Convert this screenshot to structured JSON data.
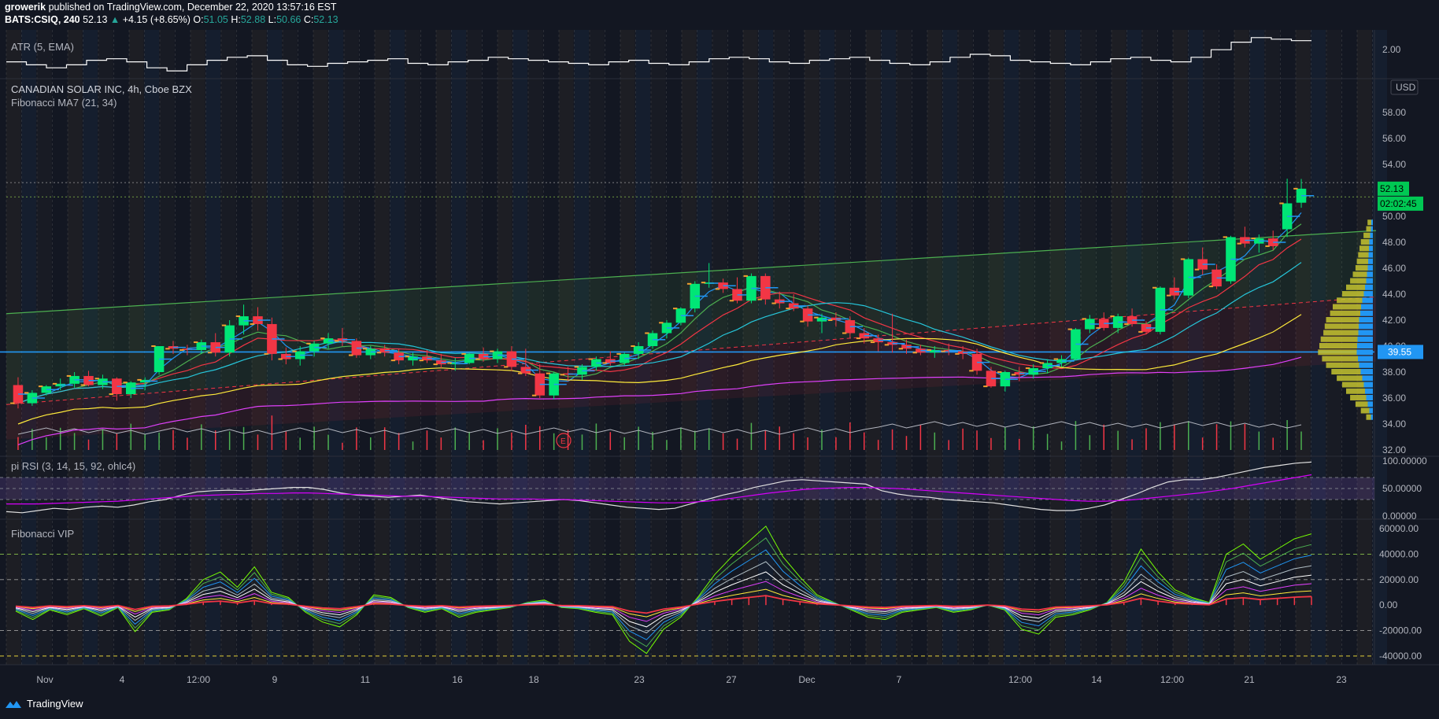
{
  "header": {
    "line1": {
      "user": "growerik",
      "rest": " published on TradingView.com, December 22, 2020 13:57:16 EST"
    },
    "line2": {
      "symbol": "BATS:CSIQ, 240",
      "last": "52.13",
      "arrow": "▲",
      "change": "+4.15 (+8.65%)",
      "o_label": "O:",
      "o": "51.05",
      "h_label": "H:",
      "h": "52.88",
      "l_label": "L:",
      "l": "50.66",
      "c_label": "C:",
      "c": "52.13"
    }
  },
  "panes": {
    "atr": {
      "label": "ATR (5, EMA)"
    },
    "main": {
      "title": "CANADIAN SOLAR INC, 4h, Cboe BZX",
      "indicator": "Fibonacci MA7 (21, 34)",
      "currency": "USD"
    },
    "rsi": {
      "label": "pi RSI (3, 14, 15, 92, ohlc4)"
    },
    "vip": {
      "label": "Fibonacci VIP"
    }
  },
  "badges": {
    "last_price": "52.13",
    "countdown": "02:02:45",
    "hline": "39.55"
  },
  "event_marker": "E",
  "footer": {
    "brand": "TradingView"
  },
  "colors": {
    "up": "#00e676",
    "down": "#f23645",
    "bg": "#131722",
    "blue": "#2196f3",
    "lime": "#4caf50",
    "yellow": "#ffeb3b",
    "magenta": "#e040fb"
  },
  "chart_data": [
    {
      "type": "line",
      "name": "ATR (5, EMA)",
      "y_ticks": [
        "2.00"
      ],
      "values": [
        1.92,
        1.9,
        1.88,
        1.9,
        1.93,
        1.94,
        1.92,
        1.88,
        1.86,
        1.9,
        1.93,
        1.95,
        1.96,
        1.93,
        1.9,
        1.89,
        1.91,
        1.92,
        1.93,
        1.94,
        1.91,
        1.9,
        1.92,
        1.93,
        1.95,
        1.94,
        1.93,
        1.92,
        1.91,
        1.9,
        1.92,
        1.93,
        1.91,
        1.9,
        1.92,
        1.94,
        1.95,
        1.94,
        1.92,
        1.91,
        1.93,
        1.94,
        1.95,
        1.93,
        1.91,
        1.9,
        1.92,
        1.95,
        1.97,
        1.96,
        1.93,
        1.92,
        1.91,
        1.9,
        1.92,
        1.94,
        1.95,
        1.93,
        1.92,
        1.95,
        2.0,
        2.05,
        2.08,
        2.07,
        2.06
      ]
    },
    {
      "type": "candlestick",
      "title": "CANADIAN SOLAR INC, 4h, Cboe BZX",
      "ylim": [
        32,
        60
      ],
      "y_ticks": [
        "58.00",
        "56.00",
        "54.00",
        "52.00",
        "50.00",
        "48.00",
        "46.00",
        "44.00",
        "42.00",
        "40.00",
        "38.00",
        "36.00",
        "34.00",
        "32.00"
      ],
      "x_ticks": [
        "Nov",
        "4",
        "12:00",
        "9",
        "11",
        "16",
        "18",
        "23",
        "27",
        "Dec",
        "7",
        "12:00",
        "14",
        "12:00",
        "21",
        "23"
      ],
      "candles": [
        [
          37.0,
          37.6,
          35.2,
          35.6
        ],
        [
          35.6,
          36.6,
          35.4,
          36.4
        ],
        [
          36.4,
          37.0,
          36.2,
          36.9
        ],
        [
          36.9,
          37.5,
          36.6,
          37.1
        ],
        [
          37.1,
          38.0,
          36.8,
          37.7
        ],
        [
          37.7,
          38.1,
          36.9,
          37.0
        ],
        [
          37.0,
          37.8,
          36.7,
          37.5
        ],
        [
          37.5,
          37.6,
          35.8,
          36.3
        ],
        [
          36.3,
          37.3,
          36.0,
          37.2
        ],
        [
          37.2,
          37.6,
          36.6,
          37.4
        ],
        [
          38.0,
          40.0,
          37.8,
          40.0
        ],
        [
          40.0,
          40.4,
          39.4,
          39.8
        ],
        [
          39.8,
          40.1,
          39.3,
          39.7
        ],
        [
          39.7,
          40.5,
          39.4,
          40.3
        ],
        [
          40.3,
          41.0,
          39.2,
          39.5
        ],
        [
          39.5,
          42.0,
          39.2,
          41.6
        ],
        [
          41.6,
          43.2,
          40.9,
          42.3
        ],
        [
          42.3,
          43.0,
          41.2,
          41.7
        ],
        [
          41.7,
          42.2,
          38.9,
          39.4
        ],
        [
          39.4,
          39.9,
          38.6,
          39.0
        ],
        [
          39.0,
          40.0,
          38.5,
          39.6
        ],
        [
          39.6,
          40.4,
          39.2,
          40.2
        ],
        [
          40.2,
          41.0,
          39.8,
          40.6
        ],
        [
          40.6,
          41.4,
          40.0,
          40.4
        ],
        [
          40.4,
          40.6,
          39.1,
          39.3
        ],
        [
          39.3,
          40.0,
          39.0,
          39.8
        ],
        [
          39.8,
          40.1,
          39.2,
          39.5
        ],
        [
          39.5,
          39.8,
          38.6,
          38.9
        ],
        [
          38.9,
          39.5,
          38.5,
          39.2
        ],
        [
          39.2,
          39.7,
          38.7,
          38.9
        ],
        [
          38.9,
          39.4,
          38.3,
          38.6
        ],
        [
          38.6,
          39.1,
          38.1,
          38.7
        ],
        [
          38.7,
          39.5,
          38.6,
          39.4
        ],
        [
          39.4,
          39.9,
          38.8,
          39.0
        ],
        [
          39.0,
          39.8,
          38.7,
          39.6
        ],
        [
          39.6,
          40.0,
          38.1,
          38.4
        ],
        [
          38.4,
          39.8,
          37.7,
          37.9
        ],
        [
          37.9,
          38.6,
          36.0,
          36.2
        ],
        [
          36.2,
          38.0,
          35.9,
          37.9
        ],
        [
          37.9,
          38.4,
          37.3,
          37.8
        ],
        [
          37.8,
          38.6,
          37.4,
          38.4
        ],
        [
          38.4,
          39.2,
          38.1,
          39.0
        ],
        [
          39.0,
          39.6,
          38.5,
          38.7
        ],
        [
          38.7,
          39.5,
          38.5,
          39.4
        ],
        [
          39.4,
          40.3,
          39.0,
          40.0
        ],
        [
          40.0,
          41.2,
          39.8,
          41.0
        ],
        [
          41.0,
          42.0,
          40.6,
          41.8
        ],
        [
          41.8,
          43.0,
          41.6,
          42.9
        ],
        [
          42.9,
          45.0,
          42.6,
          44.8
        ],
        [
          44.8,
          46.4,
          44.5,
          44.9
        ],
        [
          44.9,
          45.2,
          44.1,
          44.4
        ],
        [
          44.4,
          45.3,
          43.3,
          43.5
        ],
        [
          43.5,
          45.6,
          43.3,
          45.4
        ],
        [
          45.4,
          45.6,
          43.2,
          43.6
        ],
        [
          43.6,
          44.2,
          42.9,
          43.3
        ],
        [
          43.3,
          44.0,
          42.7,
          42.9
        ],
        [
          42.9,
          43.1,
          41.5,
          41.9
        ],
        [
          41.9,
          42.5,
          41.0,
          42.2
        ],
        [
          42.2,
          42.6,
          41.5,
          42.0
        ],
        [
          42.0,
          42.3,
          40.6,
          41.0
        ],
        [
          41.0,
          41.4,
          40.2,
          40.6
        ],
        [
          40.6,
          40.9,
          39.6,
          40.3
        ],
        [
          40.3,
          42.5,
          39.5,
          40.1
        ],
        [
          40.1,
          40.5,
          39.4,
          39.8
        ],
        [
          39.8,
          40.1,
          39.3,
          39.5
        ],
        [
          39.5,
          40.0,
          39.1,
          39.7
        ],
        [
          39.7,
          40.2,
          39.3,
          39.6
        ],
        [
          39.6,
          40.0,
          39.0,
          39.4
        ],
        [
          39.4,
          39.8,
          37.8,
          38.1
        ],
        [
          38.1,
          38.4,
          36.8,
          36.9
        ],
        [
          36.9,
          38.1,
          36.5,
          38.0
        ],
        [
          38.0,
          38.4,
          37.3,
          37.8
        ],
        [
          37.8,
          38.6,
          37.5,
          38.3
        ],
        [
          38.3,
          39.0,
          37.9,
          38.7
        ],
        [
          38.7,
          39.3,
          38.4,
          39.0
        ],
        [
          39.0,
          41.4,
          38.9,
          41.3
        ],
        [
          41.3,
          42.4,
          41.0,
          42.1
        ],
        [
          42.1,
          42.6,
          41.2,
          41.4
        ],
        [
          41.4,
          42.5,
          41.0,
          42.3
        ],
        [
          42.3,
          42.9,
          41.5,
          41.7
        ],
        [
          41.7,
          41.9,
          40.9,
          41.1
        ],
        [
          41.1,
          44.6,
          40.9,
          44.5
        ],
        [
          44.5,
          45.3,
          43.6,
          43.9
        ],
        [
          43.9,
          46.8,
          43.7,
          46.7
        ],
        [
          46.7,
          47.6,
          45.5,
          45.9
        ],
        [
          45.9,
          46.3,
          44.4,
          44.6
        ],
        [
          45.0,
          48.5,
          44.8,
          48.4
        ],
        [
          48.4,
          49.2,
          47.6,
          47.9
        ],
        [
          47.9,
          48.6,
          47.2,
          48.3
        ],
        [
          48.3,
          48.9,
          47.4,
          47.7
        ],
        [
          49.0,
          52.9,
          48.4,
          51.0
        ],
        [
          51.05,
          52.88,
          50.66,
          52.13
        ]
      ],
      "horizontal_line": 39.55,
      "last_price": 52.13
    },
    {
      "type": "line",
      "name": "pi RSI (3, 14, 15, 92, ohlc4)",
      "ylim": [
        0,
        100
      ],
      "y_ticks": [
        "100.00000",
        "50.00000",
        "0.00000"
      ],
      "series": [
        {
          "color": "white",
          "values": [
            8,
            6,
            10,
            14,
            12,
            16,
            18,
            16,
            20,
            26,
            30,
            38,
            44,
            46,
            47,
            46,
            48,
            50,
            52,
            52,
            48,
            42,
            38,
            36,
            34,
            36,
            38,
            34,
            30,
            26,
            24,
            22,
            24,
            26,
            28,
            30,
            28,
            24,
            20,
            16,
            14,
            12,
            14,
            22,
            30,
            38,
            44,
            52,
            58,
            64,
            66,
            64,
            62,
            60,
            58,
            46,
            40,
            36,
            34,
            30,
            28,
            26,
            24,
            20,
            16,
            12,
            10,
            10,
            14,
            20,
            30,
            40,
            52,
            62,
            66,
            66,
            70,
            76,
            82,
            88,
            92,
            96,
            98
          ]
        },
        {
          "color": "magenta",
          "values": [
            22,
            22,
            22,
            23,
            24,
            25,
            26,
            27,
            29,
            31,
            33,
            35,
            37,
            38,
            39,
            40,
            41,
            41,
            42,
            42,
            41,
            40,
            39,
            38,
            37,
            36,
            36,
            35,
            34,
            33,
            32,
            31,
            31,
            31,
            30,
            30,
            29,
            28,
            27,
            26,
            25,
            24,
            24,
            25,
            27,
            30,
            34,
            38,
            42,
            45,
            48,
            50,
            51,
            52,
            52,
            51,
            50,
            48,
            46,
            44,
            42,
            40,
            38,
            36,
            34,
            32,
            30,
            28,
            27,
            27,
            28,
            30,
            33,
            36,
            39,
            42,
            46,
            50,
            55,
            60,
            65,
            70,
            75
          ]
        }
      ]
    },
    {
      "type": "line",
      "name": "Fibonacci VIP",
      "ylim": [
        -45000,
        65000
      ],
      "y_ticks": [
        "60000.00",
        "40000.00",
        "20000.00",
        "0.00",
        "-20000.00",
        "-40000.00"
      ],
      "values": [
        -5000,
        -12000,
        -4000,
        -8000,
        -3000,
        -9000,
        -2000,
        -22000,
        -6000,
        -4000,
        5000,
        20000,
        26000,
        14000,
        30000,
        10000,
        6000,
        -6000,
        -14000,
        -18000,
        -8000,
        8000,
        6000,
        -2000,
        -6000,
        -3000,
        -10000,
        -6000,
        -4000,
        -2000,
        2000,
        4000,
        -2000,
        -3000,
        -6000,
        -8000,
        -30000,
        -40000,
        -20000,
        -10000,
        6000,
        24000,
        38000,
        50000,
        62000,
        38000,
        22000,
        8000,
        2000,
        -4000,
        -10000,
        -12000,
        -6000,
        -4000,
        -2000,
        -6000,
        -4000,
        0,
        -4000,
        -20000,
        -24000,
        -10000,
        -8000,
        -4000,
        2000,
        18000,
        44000,
        26000,
        12000,
        6000,
        2000,
        40000,
        48000,
        36000,
        44000,
        52000,
        56000
      ]
    }
  ]
}
